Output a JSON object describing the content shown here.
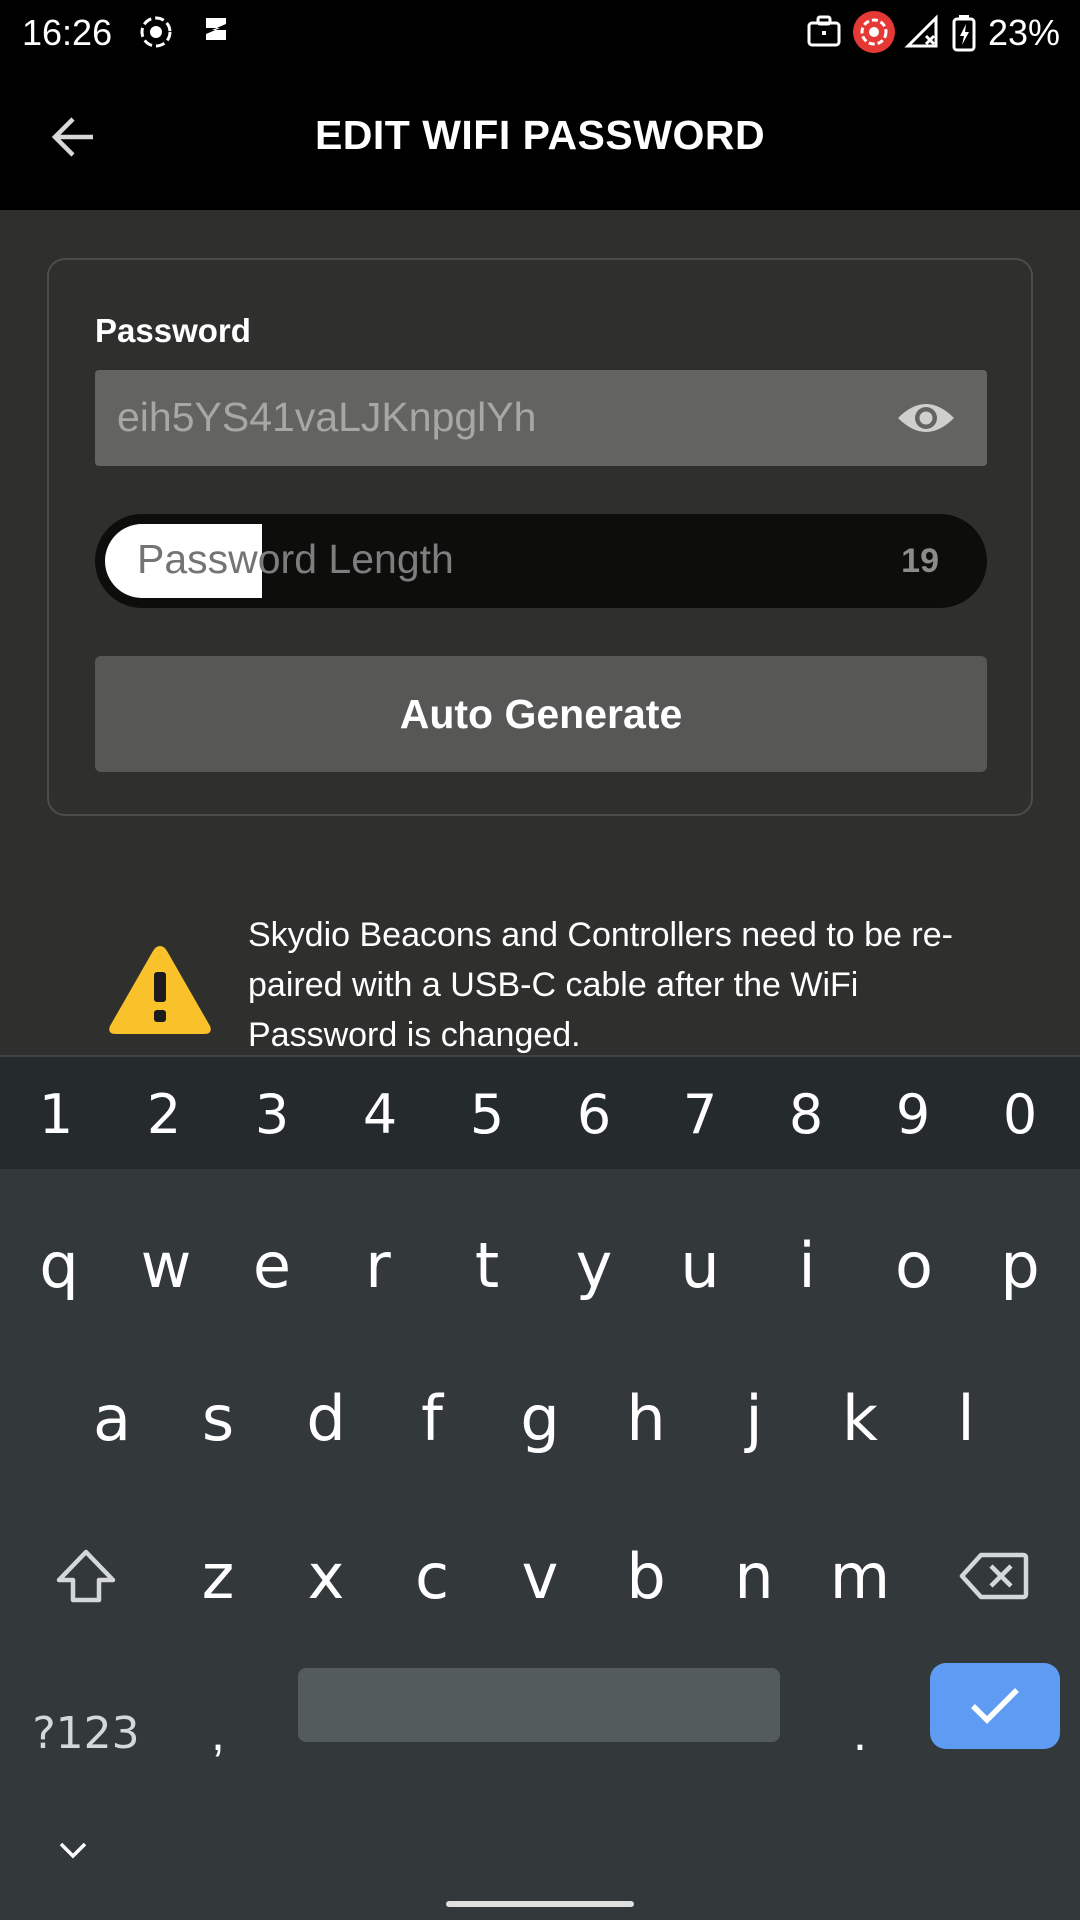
{
  "status_bar": {
    "time": "16:26",
    "battery_percent": "23%",
    "icons": [
      "screen-record-icon",
      "notification-icon",
      "work-profile-icon",
      "record-active-icon",
      "signal-off-icon",
      "battery-charging-icon"
    ],
    "record_color": "#e53935"
  },
  "app_bar": {
    "title": "EDIT WIFI PASSWORD",
    "back_icon": "arrow-back-icon"
  },
  "form": {
    "password_label": "Password",
    "password_value": "eih5YS41vaLJKnpglYh",
    "visibility_icon": "eye-icon",
    "length_label": "Password Length",
    "length_value": "19",
    "length_fill_fraction": 0.18,
    "auto_generate_label": "Auto Generate"
  },
  "warning": {
    "icon": "warning-triangle-icon",
    "color": "#f9c22b",
    "text": "Skydio Beacons and Controllers need to be re-paired with a USB-C cable after the WiFi Password is changed."
  },
  "keyboard": {
    "number_row": [
      "1",
      "2",
      "3",
      "4",
      "5",
      "6",
      "7",
      "8",
      "9",
      "0"
    ],
    "row1": [
      "q",
      "w",
      "e",
      "r",
      "t",
      "y",
      "u",
      "i",
      "o",
      "p"
    ],
    "row2": [
      "a",
      "s",
      "d",
      "f",
      "g",
      "h",
      "j",
      "k",
      "l"
    ],
    "row3": [
      "z",
      "x",
      "c",
      "v",
      "b",
      "n",
      "m"
    ],
    "symbols_label": "?123",
    "comma": ",",
    "period": ".",
    "shift_icon": "shift-icon",
    "backspace_icon": "backspace-icon",
    "enter_icon": "check-icon",
    "hide_icon": "chevron-down-icon",
    "enter_color": "#5e9cf3"
  }
}
